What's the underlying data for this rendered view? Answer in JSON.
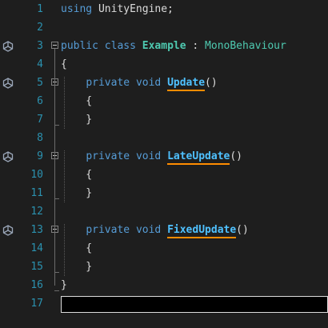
{
  "editor": {
    "lines": [
      {
        "n": "1",
        "t": [
          {
            "c": "kw",
            "v": "using"
          },
          {
            "c": "punc",
            "v": " UnityEngine;"
          }
        ]
      },
      {
        "n": "2",
        "t": []
      },
      {
        "n": "3",
        "t": [
          {
            "c": "kw",
            "v": "public"
          },
          {
            "c": "punc",
            "v": " "
          },
          {
            "c": "kw",
            "v": "class"
          },
          {
            "c": "punc",
            "v": " "
          },
          {
            "c": "cls",
            "v": "Example"
          },
          {
            "c": "punc",
            "v": " : "
          },
          {
            "c": "ty",
            "v": "MonoBehaviour"
          }
        ]
      },
      {
        "n": "4",
        "t": [
          {
            "c": "punc",
            "v": "{"
          }
        ]
      },
      {
        "n": "5",
        "t": [
          {
            "c": "punc",
            "v": "    "
          },
          {
            "c": "kw",
            "v": "private"
          },
          {
            "c": "punc",
            "v": " "
          },
          {
            "c": "kw",
            "v": "void"
          },
          {
            "c": "punc",
            "v": " "
          },
          {
            "c": "meth",
            "v": "Update"
          },
          {
            "c": "punc",
            "v": "()"
          }
        ]
      },
      {
        "n": "6",
        "t": [
          {
            "c": "punc",
            "v": "    {"
          }
        ]
      },
      {
        "n": "7",
        "t": [
          {
            "c": "punc",
            "v": "    }"
          }
        ]
      },
      {
        "n": "8",
        "t": []
      },
      {
        "n": "9",
        "t": [
          {
            "c": "punc",
            "v": "    "
          },
          {
            "c": "kw",
            "v": "private"
          },
          {
            "c": "punc",
            "v": " "
          },
          {
            "c": "kw",
            "v": "void"
          },
          {
            "c": "punc",
            "v": " "
          },
          {
            "c": "meth",
            "v": "LateUpdate"
          },
          {
            "c": "punc",
            "v": "()"
          }
        ]
      },
      {
        "n": "10",
        "t": [
          {
            "c": "punc",
            "v": "    {"
          }
        ]
      },
      {
        "n": "11",
        "t": [
          {
            "c": "punc",
            "v": "    }"
          }
        ]
      },
      {
        "n": "12",
        "t": []
      },
      {
        "n": "13",
        "t": [
          {
            "c": "punc",
            "v": "    "
          },
          {
            "c": "kw",
            "v": "private"
          },
          {
            "c": "punc",
            "v": " "
          },
          {
            "c": "kw",
            "v": "void"
          },
          {
            "c": "punc",
            "v": " "
          },
          {
            "c": "meth",
            "v": "FixedUpdate"
          },
          {
            "c": "punc",
            "v": "()"
          }
        ]
      },
      {
        "n": "14",
        "t": [
          {
            "c": "punc",
            "v": "    {"
          }
        ]
      },
      {
        "n": "15",
        "t": [
          {
            "c": "punc",
            "v": "    }"
          }
        ]
      },
      {
        "n": "16",
        "t": [
          {
            "c": "punc",
            "v": "}"
          }
        ]
      },
      {
        "n": "17",
        "t": []
      }
    ],
    "unity_icon_lines": [
      "3",
      "5",
      "9",
      "13"
    ],
    "fold_lines": [
      "3",
      "5",
      "9",
      "13"
    ],
    "icon": "unity-icon",
    "colors": {
      "background": "#1e1e1e",
      "line_number": "#2b91af",
      "keyword": "#569cd6",
      "type": "#4ec9b0",
      "method": "#4fc1ff",
      "underline": "#ff8c00",
      "text": "#dcdcdc"
    }
  }
}
